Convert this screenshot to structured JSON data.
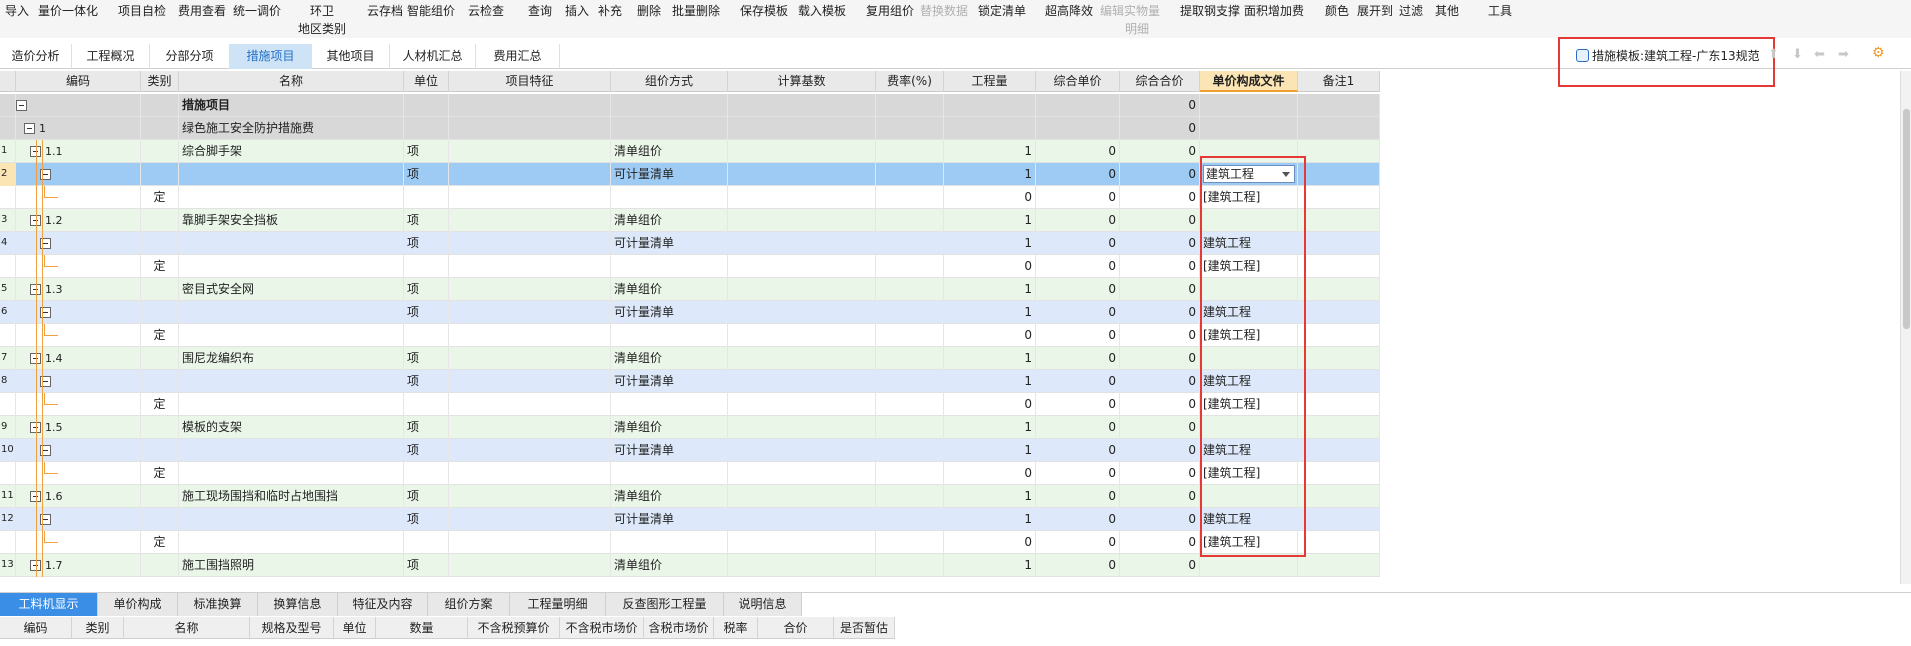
{
  "toolbar": {
    "items": [
      "导入",
      "量价一体化",
      "项目自检",
      "费用查看",
      "统一调价",
      "环卫",
      "地区类别",
      "云存档",
      "智能组价",
      "云检查",
      "查询",
      "插入",
      "补充",
      "删除",
      "批量删除",
      "保存模板",
      "载入模板",
      "复用组价",
      "替换数据",
      "锁定清单",
      "超高降效",
      "编辑实物量",
      "明细",
      "提取钢支撑",
      "面积增加费",
      "颜色",
      "展开到",
      "过滤",
      "其他",
      "工具"
    ]
  },
  "tabs": [
    "造价分析",
    "工程概况",
    "分部分项",
    "措施项目",
    "其他项目",
    "人材机汇总",
    "费用汇总"
  ],
  "active_tab": "措施项目",
  "template": {
    "label": "措施模板:建筑工程-广东13规范"
  },
  "columns": [
    "编码",
    "类别",
    "名称",
    "单位",
    "项目特征",
    "组价方式",
    "计算基数",
    "费率(%)",
    "工程量",
    "综合单价",
    "综合合价",
    "单价构成文件",
    "备注1"
  ],
  "rows": [
    {
      "no": "",
      "code": "",
      "cat": "",
      "name": "措施项目",
      "unit": "",
      "method": "",
      "qty": "",
      "price": "",
      "total": "0",
      "file": ""
    },
    {
      "no": "",
      "code": "1",
      "cat": "",
      "name": "绿色施工安全防护措施费",
      "unit": "",
      "method": "",
      "qty": "",
      "price": "",
      "total": "0",
      "file": ""
    },
    {
      "no": "1",
      "code": "1.1",
      "cat": "",
      "name": "综合脚手架",
      "unit": "项",
      "method": "清单组价",
      "qty": "1",
      "price": "0",
      "total": "0",
      "file": ""
    },
    {
      "no": "2",
      "code": "",
      "cat": "",
      "name": "",
      "unit": "项",
      "method": "可计量清单",
      "qty": "1",
      "price": "0",
      "total": "0",
      "file": "建筑工程"
    },
    {
      "no": "",
      "code": "",
      "cat": "定",
      "name": "",
      "unit": "",
      "method": "",
      "qty": "0",
      "price": "0",
      "total": "0",
      "file": "[建筑工程]"
    },
    {
      "no": "3",
      "code": "1.2",
      "cat": "",
      "name": "靠脚手架安全挡板",
      "unit": "项",
      "method": "清单组价",
      "qty": "1",
      "price": "0",
      "total": "0",
      "file": ""
    },
    {
      "no": "4",
      "code": "",
      "cat": "",
      "name": "",
      "unit": "项",
      "method": "可计量清单",
      "qty": "1",
      "price": "0",
      "total": "0",
      "file": "建筑工程"
    },
    {
      "no": "",
      "code": "",
      "cat": "定",
      "name": "",
      "unit": "",
      "method": "",
      "qty": "0",
      "price": "0",
      "total": "0",
      "file": "[建筑工程]"
    },
    {
      "no": "5",
      "code": "1.3",
      "cat": "",
      "name": "密目式安全网",
      "unit": "项",
      "method": "清单组价",
      "qty": "1",
      "price": "0",
      "total": "0",
      "file": ""
    },
    {
      "no": "6",
      "code": "",
      "cat": "",
      "name": "",
      "unit": "项",
      "method": "可计量清单",
      "qty": "1",
      "price": "0",
      "total": "0",
      "file": "建筑工程"
    },
    {
      "no": "",
      "code": "",
      "cat": "定",
      "name": "",
      "unit": "",
      "method": "",
      "qty": "0",
      "price": "0",
      "total": "0",
      "file": "[建筑工程]"
    },
    {
      "no": "7",
      "code": "1.4",
      "cat": "",
      "name": "围尼龙编织布",
      "unit": "项",
      "method": "清单组价",
      "qty": "1",
      "price": "0",
      "total": "0",
      "file": ""
    },
    {
      "no": "8",
      "code": "",
      "cat": "",
      "name": "",
      "unit": "项",
      "method": "可计量清单",
      "qty": "1",
      "price": "0",
      "total": "0",
      "file": "建筑工程"
    },
    {
      "no": "",
      "code": "",
      "cat": "定",
      "name": "",
      "unit": "",
      "method": "",
      "qty": "0",
      "price": "0",
      "total": "0",
      "file": "[建筑工程]"
    },
    {
      "no": "9",
      "code": "1.5",
      "cat": "",
      "name": "模板的支架",
      "unit": "项",
      "method": "清单组价",
      "qty": "1",
      "price": "0",
      "total": "0",
      "file": ""
    },
    {
      "no": "10",
      "code": "",
      "cat": "",
      "name": "",
      "unit": "项",
      "method": "可计量清单",
      "qty": "1",
      "price": "0",
      "total": "0",
      "file": "建筑工程"
    },
    {
      "no": "",
      "code": "",
      "cat": "定",
      "name": "",
      "unit": "",
      "method": "",
      "qty": "0",
      "price": "0",
      "total": "0",
      "file": "[建筑工程]"
    },
    {
      "no": "11",
      "code": "1.6",
      "cat": "",
      "name": "施工现场围挡和临时占地围挡",
      "unit": "项",
      "method": "清单组价",
      "qty": "1",
      "price": "0",
      "total": "0",
      "file": ""
    },
    {
      "no": "12",
      "code": "",
      "cat": "",
      "name": "",
      "unit": "项",
      "method": "可计量清单",
      "qty": "1",
      "price": "0",
      "total": "0",
      "file": "建筑工程"
    },
    {
      "no": "",
      "code": "",
      "cat": "定",
      "name": "",
      "unit": "",
      "method": "",
      "qty": "0",
      "price": "0",
      "total": "0",
      "file": "[建筑工程]"
    },
    {
      "no": "13",
      "code": "1.7",
      "cat": "",
      "name": "施工围挡照明",
      "unit": "项",
      "method": "清单组价",
      "qty": "1",
      "price": "0",
      "total": "0",
      "file": ""
    }
  ],
  "bottom_tabs": [
    "工料机显示",
    "单价构成",
    "标准换算",
    "换算信息",
    "特征及内容",
    "组价方案",
    "工程量明细",
    "反查图形工程量",
    "说明信息"
  ],
  "bottom_columns": [
    "编码",
    "类别",
    "名称",
    "规格及型号",
    "单位",
    "数量",
    "不含税预算价",
    "不含税市场价",
    "含税市场价",
    "税率",
    "合价",
    "是否暂估"
  ],
  "colors": {
    "accent": "#3a8ee6",
    "highlight": "#e53935",
    "selected_row": "#9ecbf4"
  }
}
